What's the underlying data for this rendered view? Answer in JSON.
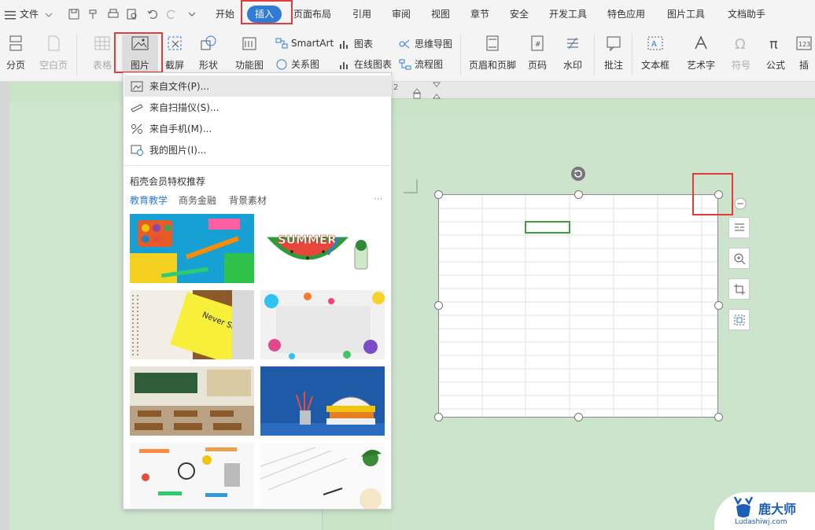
{
  "menubar": {
    "file_label": "文件",
    "tabs": [
      "开始",
      "插入",
      "页面布局",
      "引用",
      "审阅",
      "视图",
      "章节",
      "安全",
      "开发工具",
      "特色应用",
      "图片工具",
      "文档助手"
    ],
    "active_tab": "插入"
  },
  "ribbon": {
    "page_break": "分页",
    "blank_page": "空白页",
    "table": "表格",
    "picture": "图片",
    "screenshot": "截屏",
    "shape": "形状",
    "function_chart": "功能图",
    "smartart": "SmartArt",
    "chart": "图表",
    "mindmap": "思维导图",
    "relation": "关系图",
    "online_chart": "在线图表",
    "flowchart": "流程图",
    "header_footer": "页眉和页脚",
    "page_number": "页码",
    "watermark": "水印",
    "comment": "批注",
    "textbox": "文本框",
    "wordart": "艺术字",
    "symbol": "符号",
    "formula": "公式",
    "insert_number_partial": "插"
  },
  "ruler": {
    "tick_label": "2"
  },
  "picture_menu": {
    "items": [
      "来自文件(P)...",
      "来自扫描仪(S)...",
      "来自手机(M)...",
      "我的图片(I)..."
    ],
    "section_title": "稻壳会员特权推荐",
    "tabs": [
      "教育教学",
      "商务金融",
      "背景素材"
    ],
    "more": "···",
    "summer_text": "SUMMER",
    "notebook_text": "Never Stop Learning"
  },
  "watermark_logo": {
    "name": "鹿大师",
    "url": "Ludashiwj.com"
  },
  "colors": {
    "accent": "#2f7bd6",
    "highlight_red": "#e23b3b",
    "doc_bg": "#c9e3c9",
    "cell_select": "#3aa13a"
  }
}
